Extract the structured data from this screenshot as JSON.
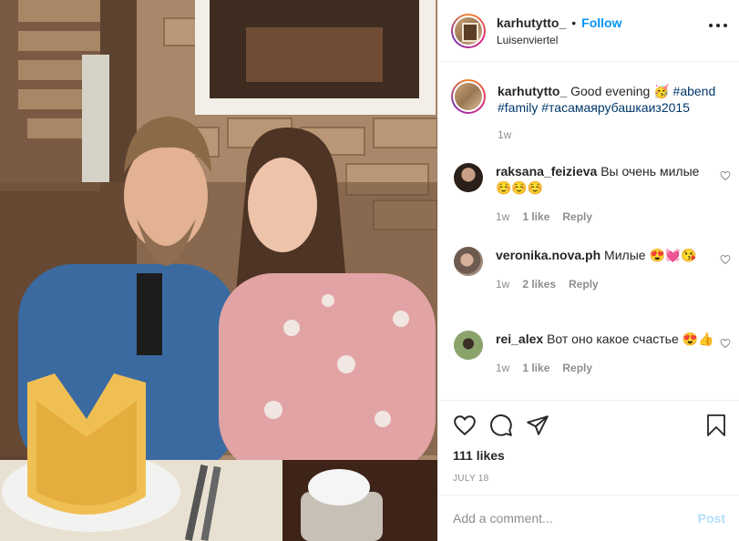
{
  "header": {
    "username": "karhutytto_",
    "separator": "•",
    "follow_label": "Follow",
    "location": "Luisenviertel"
  },
  "caption": {
    "username": "karhutytto_",
    "text": "Good evening",
    "emoji": "🥳",
    "hashtags": [
      "#abend",
      "#family",
      "#тасамаярубашкаиз2015"
    ],
    "time": "1w"
  },
  "comments": [
    {
      "username": "raksana_feizieva",
      "text": "Вы очень милые",
      "emoji": "☺️☺️☺️",
      "time": "1w",
      "likes": "1 like",
      "reply": "Reply"
    },
    {
      "username": "veronika.nova.ph",
      "text": "Милые",
      "emoji": "😍💓😘",
      "time": "1w",
      "likes": "2 likes",
      "reply": "Reply"
    },
    {
      "username": "rei_alex",
      "text": "Вот оно какое счастье",
      "emoji": "😍👍",
      "time": "1w",
      "likes": "1 like",
      "reply": "Reply"
    }
  ],
  "actions": {
    "likes": "111 likes",
    "date": "JULY 18"
  },
  "add_comment": {
    "placeholder": "Add a comment...",
    "post_label": "Post"
  },
  "colors": {
    "accent": "#0095f6",
    "hashtag": "#00376b",
    "muted": "#8e8e8e",
    "post_disabled": "#b2dffc"
  },
  "icons": [
    "more-icon",
    "heart-icon",
    "comment-icon",
    "share-icon",
    "bookmark-icon"
  ]
}
